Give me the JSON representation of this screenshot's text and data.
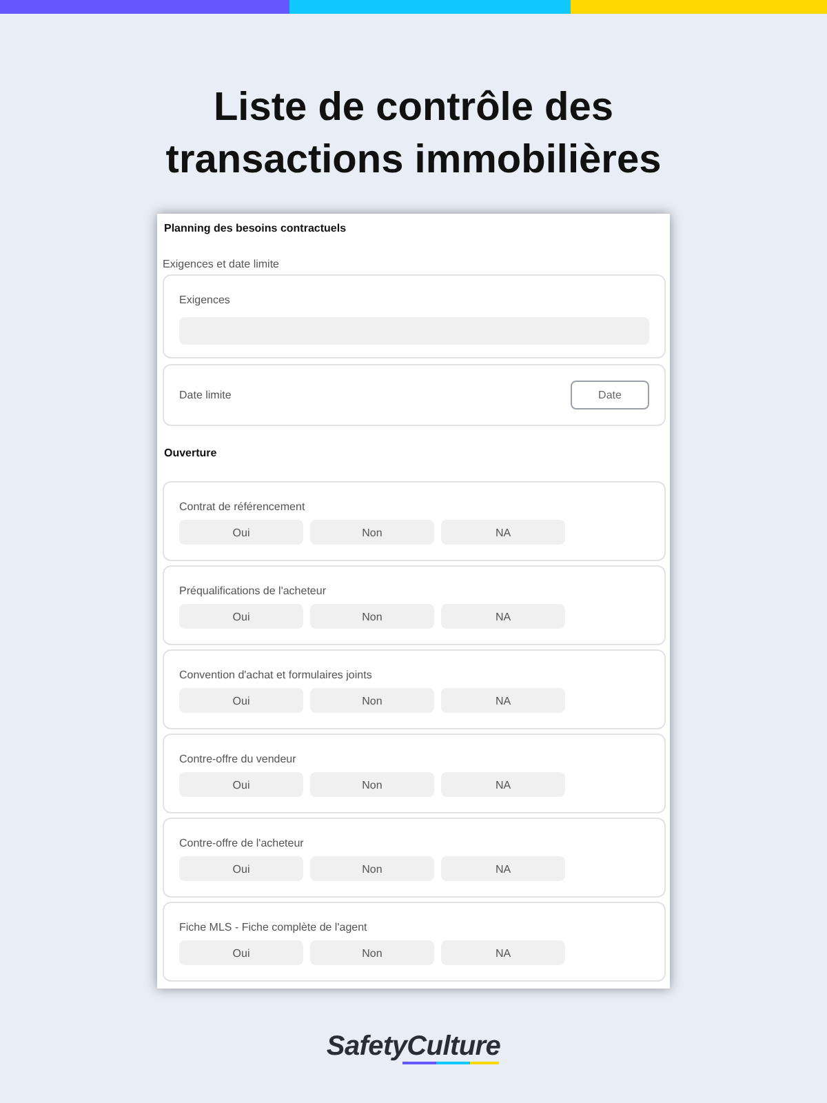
{
  "title": "Liste de contrôle des transactions immobilières",
  "form": {
    "heading": "Planning des besoins contractuels",
    "groups": [
      {
        "kind": "subsection",
        "title": "Exigences et date limite",
        "items": [
          {
            "kind": "text",
            "label": "Exigences"
          },
          {
            "kind": "date",
            "label": "Date limite",
            "button": "Date"
          }
        ]
      },
      {
        "kind": "section",
        "title": "Ouverture",
        "items": [
          {
            "kind": "choice",
            "label": "Contrat de référencement",
            "options": [
              {
                "label": "Oui",
                "selected": false
              },
              {
                "label": "Non",
                "selected": false
              },
              {
                "label": "NA",
                "selected": false
              }
            ]
          },
          {
            "kind": "choice",
            "label": "Préqualifications de l'acheteur",
            "options": [
              {
                "label": "Oui",
                "selected": false
              },
              {
                "label": "Non",
                "selected": false
              },
              {
                "label": "NA",
                "selected": false
              }
            ]
          },
          {
            "kind": "choice",
            "label": "Convention d'achat et formulaires joints",
            "options": [
              {
                "label": "Oui",
                "selected": false
              },
              {
                "label": "Non",
                "selected": false
              },
              {
                "label": "NA",
                "selected": false
              }
            ]
          },
          {
            "kind": "choice",
            "label": "Contre-offre du vendeur",
            "options": [
              {
                "label": "Oui",
                "selected": false
              },
              {
                "label": "Non",
                "selected": false
              },
              {
                "label": "NA",
                "selected": false
              }
            ]
          },
          {
            "kind": "choice",
            "label": "Contre-offre de l'acheteur",
            "options": [
              {
                "label": "Oui",
                "selected": false
              },
              {
                "label": "Non",
                "selected": false
              },
              {
                "label": "NA",
                "selected": false
              }
            ]
          },
          {
            "kind": "choice",
            "label": "Fiche MLS - Fiche complète de l'agent",
            "options": [
              {
                "label": "Oui",
                "selected": false
              },
              {
                "label": "Non",
                "selected": false
              },
              {
                "label": "NA",
                "selected": false
              }
            ]
          }
        ]
      }
    ]
  },
  "brand": {
    "name": "SafetyCulture"
  }
}
